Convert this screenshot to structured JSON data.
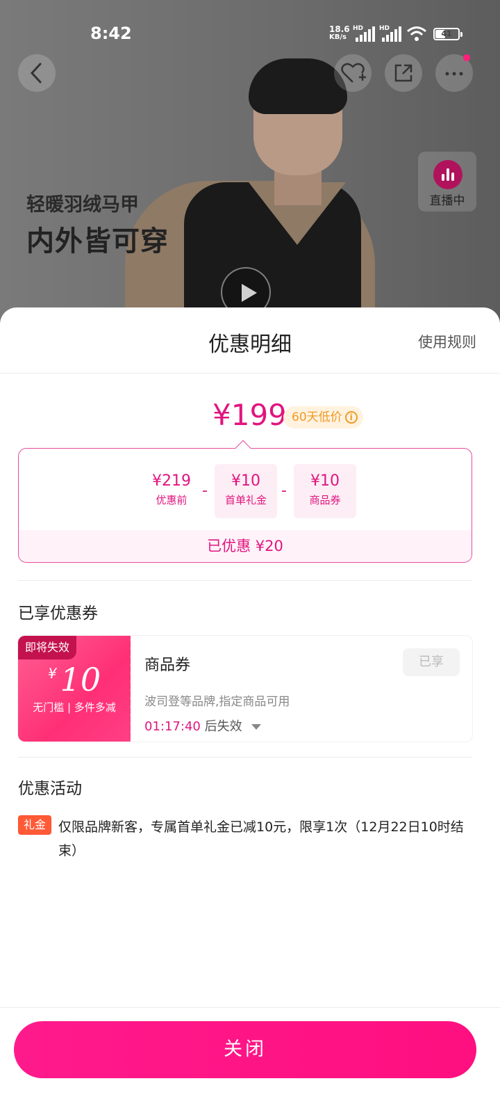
{
  "status_bar": {
    "time": "8:42",
    "net_speed_value": "18.6",
    "net_speed_unit": "KB/s",
    "signal1_label": "HD",
    "signal2_label": "HD",
    "battery": "41"
  },
  "product_banner": {
    "subtitle": "轻暖羽绒马甲",
    "title": "内外皆可穿",
    "live_label": "直播中"
  },
  "sheet": {
    "title": "优惠明细",
    "rules_link": "使用规则",
    "final_price": "¥199",
    "price_tag": "60天低价",
    "price_tag_icon": "i",
    "breakdown": {
      "items": [
        {
          "amount": "¥219",
          "label": "优惠前"
        },
        {
          "amount": "¥10",
          "label": "首单礼金"
        },
        {
          "amount": "¥10",
          "label": "商品券"
        }
      ],
      "operators": [
        "-",
        "-"
      ],
      "total": "已优惠 ¥20"
    },
    "coupons_section_title": "已享优惠券",
    "coupon": {
      "expire_tag": "即将失效",
      "currency": "¥",
      "value": "10",
      "condition": "无门槛 | 多件多减",
      "name": "商品券",
      "description": "波司登等品牌,指定商品可用",
      "timer": "01:17:40",
      "timer_suffix": "后失效",
      "status_button": "已享"
    },
    "activities_section_title": "优惠活动",
    "activity": {
      "badge": "礼金",
      "text": "仅限品牌新客，专属首单礼金已减10元，限享1次（12月22日10时结束）"
    },
    "close_button": "关闭"
  },
  "colors": {
    "accent": "#e0157f",
    "button": "#ff1a8c",
    "badge": "#ff5a36",
    "price_tag": "#f09a25"
  }
}
